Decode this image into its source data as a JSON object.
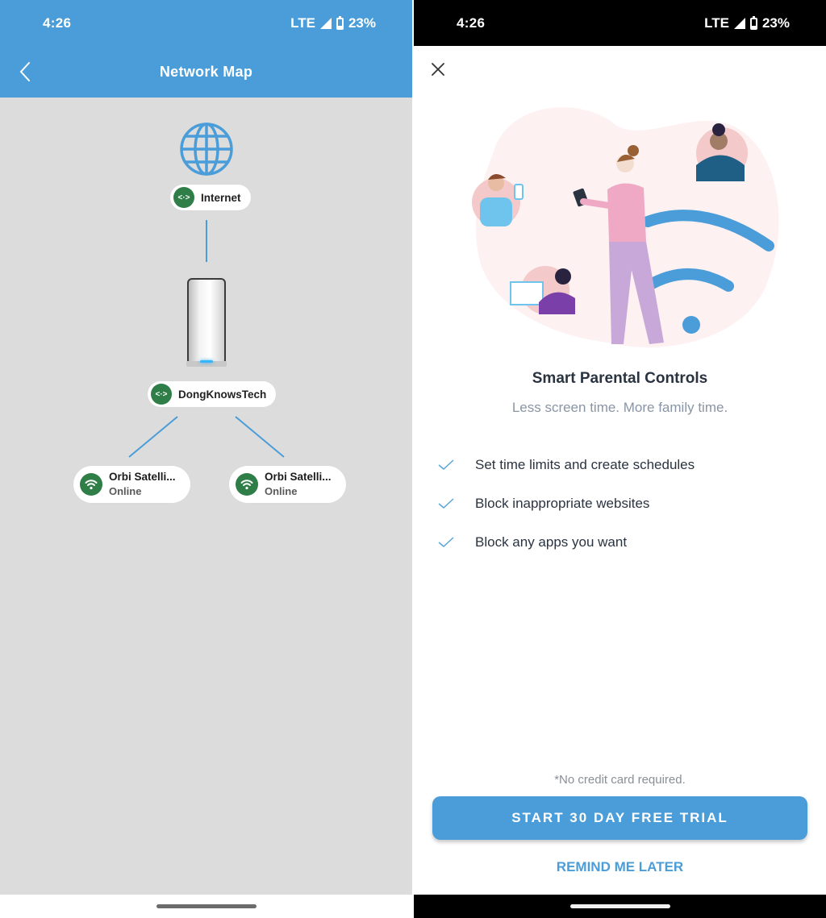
{
  "left": {
    "status_bar": {
      "time": "4:26",
      "network": "LTE",
      "battery": "23%",
      "battery_level": 0.23
    },
    "app_bar": {
      "title": "Network Map",
      "back_icon": "chevron-left-icon"
    },
    "network_map": {
      "internet": {
        "icon": "globe-icon",
        "label": "Internet",
        "badge_icon": "code-arrows-icon"
      },
      "router": {
        "label": "DongKnowsTech",
        "badge_icon": "code-arrows-icon"
      },
      "satellites": [
        {
          "name": "Orbi Satelli...",
          "status": "Online",
          "icon": "wifi-icon"
        },
        {
          "name": "Orbi Satelli...",
          "status": "Online",
          "icon": "wifi-icon"
        }
      ],
      "colors": {
        "accent": "#4a9dd8",
        "status_green": "#2f7d47",
        "background": "#dcdcdc"
      }
    }
  },
  "right": {
    "status_bar": {
      "time": "4:26",
      "network": "LTE",
      "battery": "23%",
      "battery_level": 0.23
    },
    "close_icon": "close-icon",
    "illustration": "family-wifi-illustration",
    "title": "Smart Parental Controls",
    "subtitle": "Less screen time. More family time.",
    "features": [
      {
        "icon": "check-icon",
        "text": "Set time limits and create schedules"
      },
      {
        "icon": "check-icon",
        "text": "Block inappropriate websites"
      },
      {
        "icon": "check-icon",
        "text": "Block any apps you want"
      }
    ],
    "note": "*No credit card required.",
    "cta_label": "START 30 DAY FREE TRIAL",
    "secondary_label": "REMIND ME LATER",
    "colors": {
      "accent": "#4a9dd8",
      "title": "#2a3340",
      "subtitle": "#8995a5"
    }
  }
}
